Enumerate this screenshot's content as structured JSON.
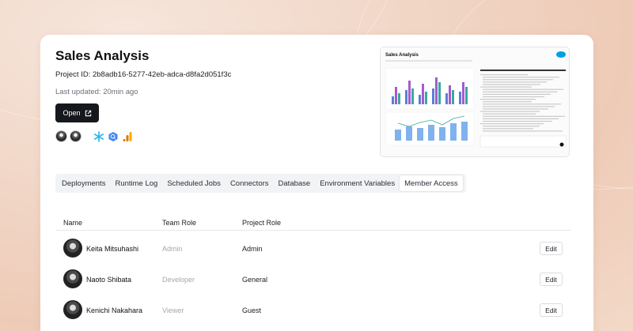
{
  "project": {
    "title": "Sales Analysis",
    "project_id": "Project ID: 2b8adb16-5277-42eb-adca-d8fa2d051f3c",
    "last_updated": "Last updated: 20min ago",
    "open_label": "Open"
  },
  "preview": {
    "title": "Sales Analysis"
  },
  "tabs": [
    {
      "label": "Deployments"
    },
    {
      "label": "Runtime Log"
    },
    {
      "label": "Scheduled Jobs"
    },
    {
      "label": "Connectors"
    },
    {
      "label": "Database"
    },
    {
      "label": "Environment Variables"
    },
    {
      "label": "Member Access",
      "active": true
    }
  ],
  "table": {
    "headers": {
      "name": "Name",
      "team_role": "Team Role",
      "project_role": "Project Role"
    },
    "edit_label": "Edit",
    "rows": [
      {
        "name": "Keita Mitsuhashi",
        "team_role": "Admin",
        "project_role": "Admin"
      },
      {
        "name": "Naoto Shibata",
        "team_role": "Developer",
        "project_role": "General"
      },
      {
        "name": "Kenichi Nakahara",
        "team_role": "Viewer",
        "project_role": "Guest"
      }
    ]
  },
  "colors": {
    "accent_dark": "#15181c",
    "snowflake": "#29b5e8",
    "bigquery": "#4386fa",
    "analytics": "#f9ab00"
  },
  "icons": [
    "external-link-icon",
    "snowflake-icon",
    "bigquery-icon",
    "google-analytics-icon",
    "salesforce-icon"
  ]
}
